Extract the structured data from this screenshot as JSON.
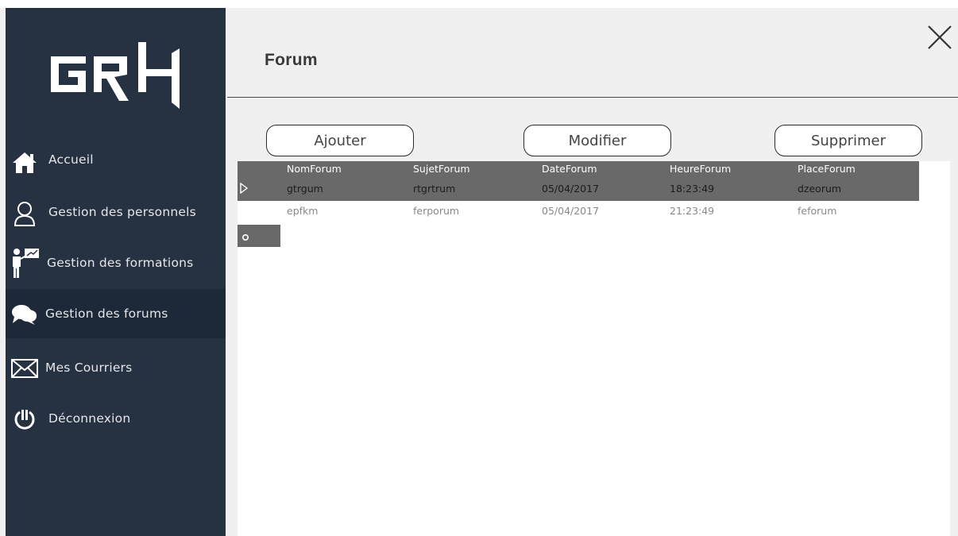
{
  "app": {
    "logo": "GRH"
  },
  "sidebar": {
    "items": [
      {
        "label": "Accueil",
        "icon": "home-icon"
      },
      {
        "label": "Gestion des personnels",
        "icon": "user-icon"
      },
      {
        "label": "Gestion des formations",
        "icon": "presenter-icon"
      },
      {
        "label": "Gestion des forums",
        "icon": "chat-icon",
        "active": true
      },
      {
        "label": "Mes Courriers",
        "icon": "mail-icon"
      },
      {
        "label": "Déconnexion",
        "icon": "power-icon"
      }
    ]
  },
  "main": {
    "title": "Forum",
    "buttons": {
      "add": "Ajouter",
      "edit": "Modifier",
      "delete": "Supprimer"
    }
  },
  "grid": {
    "columns": [
      "NomForum",
      "SujetForum",
      "DateForum",
      "HeureForum",
      "PlaceForum"
    ],
    "rows": [
      [
        "gtrgum",
        "rtgrtrum",
        "05/04/2017",
        "18:23:49",
        "dzeorum"
      ],
      [
        "epfkm",
        "ferporum",
        "05/04/2017",
        "21:23:49",
        "feforum"
      ]
    ],
    "selected_row": 0
  },
  "colors": {
    "sidebar_bg": "#263241",
    "sidebar_active": "#1d2838",
    "grid_header": "#696969",
    "main_bg": "#f0f0f0"
  }
}
